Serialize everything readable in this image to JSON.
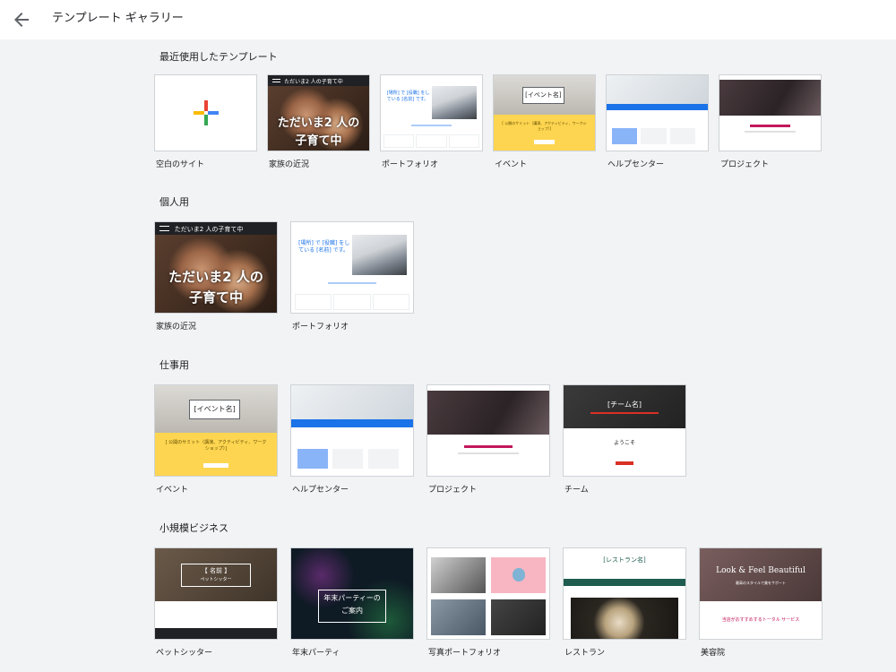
{
  "header": {
    "title": "テンプレート ギャラリー"
  },
  "sections": {
    "recent": {
      "title": "最近使用したテンプレート",
      "items": [
        "空白のサイト",
        "家族の近況",
        "ポートフォリオ",
        "イベント",
        "ヘルプセンター",
        "プロジェクト"
      ]
    },
    "personal": {
      "title": "個人用",
      "items": [
        "家族の近況",
        "ポートフォリオ"
      ]
    },
    "work": {
      "title": "仕事用",
      "items": [
        "イベント",
        "ヘルプセンター",
        "プロジェクト",
        "チーム"
      ]
    },
    "small_business": {
      "title": "小規模ビジネス",
      "items": [
        "ペットシッター",
        "年末パーティ",
        "写真ポートフォリオ",
        "レストラン",
        "美容院"
      ]
    }
  },
  "thumbs": {
    "family_title": "ただいま2 人の子育て中",
    "family_big_1": "ただいま2 人の",
    "family_big_2": "子育て中",
    "portfolio_text": "[場所] で [役職] をしている [名前] です。",
    "event_name": "[イベント名]",
    "event_note": "[ 公開のサミット（講演、アクティビティ、ワークショップ）]",
    "team_name": "[チーム名]",
    "team_welcome": "ようこそ",
    "pet_name": "【 名前 】",
    "pet_role": "ペットシッター",
    "party_1": "年末パーティーの",
    "party_2": "ご案内",
    "restaurant_name": "[レストラン名]",
    "beauty_title": "Look & Feel Beautiful",
    "beauty_sub": "最高のスタイルで美をサポート",
    "beauty_pink": "当店がおすすめするトータル サービス"
  },
  "colors": {
    "accent_blue": "#1a73e8",
    "event_yellow": "#fdd550",
    "team_red": "#d93025"
  }
}
